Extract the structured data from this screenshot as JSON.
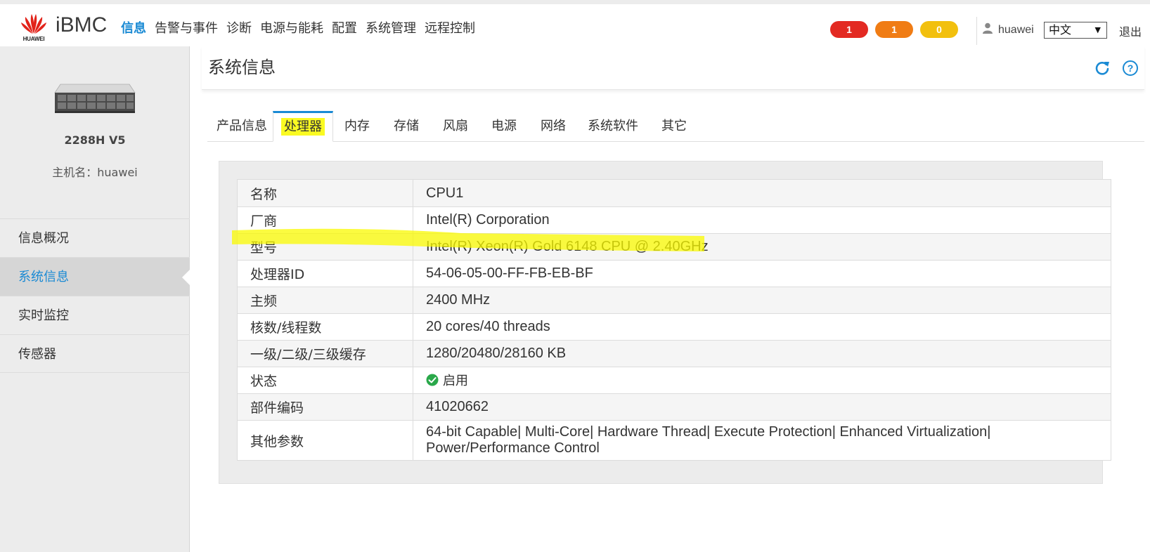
{
  "header": {
    "logo_text": "HUAWEI",
    "product": "iBMC",
    "nav": [
      "信息",
      "告警与事件",
      "诊断",
      "电源与能耗",
      "配置",
      "系统管理",
      "远程控制"
    ],
    "alarms": {
      "critical": "1",
      "major": "1",
      "minor": "0"
    },
    "user": "huawei",
    "language": "中文",
    "logout": "退出",
    "accent_color": "#1a8ad4"
  },
  "sidebar": {
    "model": "2288H V5",
    "hostname": "主机名：huawei",
    "items": [
      {
        "label": "信息概况"
      },
      {
        "label": "系统信息"
      },
      {
        "label": "实时监控"
      },
      {
        "label": "传感器"
      }
    ]
  },
  "main": {
    "title": "系统信息",
    "tabs": [
      "产品信息",
      "处理器",
      "内存",
      "存储",
      "风扇",
      "电源",
      "网络",
      "系统软件",
      "其它"
    ],
    "active_tab": "处理器",
    "processor": {
      "rows": [
        {
          "label": "名称",
          "value": "CPU1"
        },
        {
          "label": "厂商",
          "value": "Intel(R) Corporation"
        },
        {
          "label": "型号",
          "value": "Intel(R) Xeon(R) Gold 6148 CPU @ 2.40GHz"
        },
        {
          "label": "处理器ID",
          "value": "54-06-05-00-FF-FB-EB-BF"
        },
        {
          "label": "主频",
          "value": "2400 MHz"
        },
        {
          "label": "核数/线程数",
          "value": "20 cores/40 threads"
        },
        {
          "label": "一级/二级/三级缓存",
          "value": "1280/20480/28160 KB"
        },
        {
          "label": "状态",
          "value": "启用"
        },
        {
          "label": "部件编码",
          "value": "41020662"
        },
        {
          "label": "其他参数",
          "value": "64-bit Capable| Multi-Core| Hardware Thread| Execute Protection| Enhanced Virtualization|",
          "value2": "Power/Performance Control"
        }
      ]
    }
  }
}
